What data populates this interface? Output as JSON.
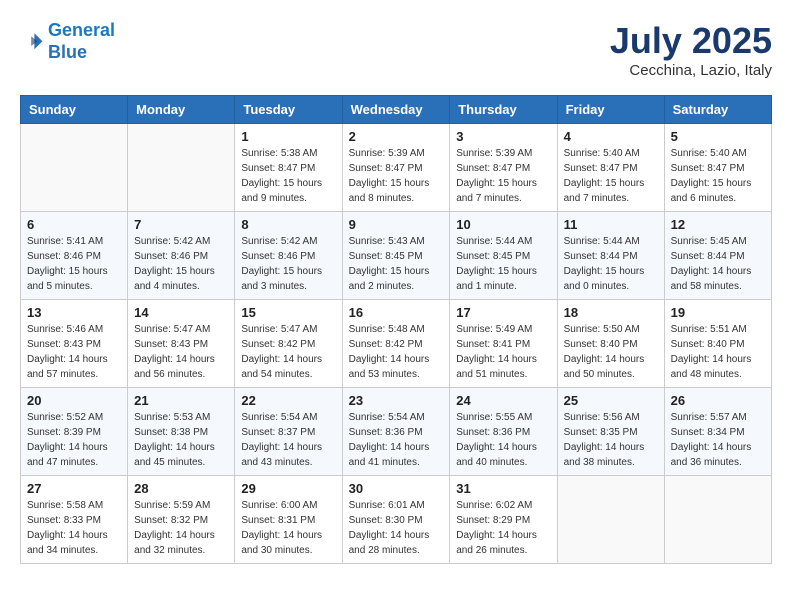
{
  "header": {
    "logo_line1": "General",
    "logo_line2": "Blue",
    "month": "July 2025",
    "location": "Cecchina, Lazio, Italy"
  },
  "weekdays": [
    "Sunday",
    "Monday",
    "Tuesday",
    "Wednesday",
    "Thursday",
    "Friday",
    "Saturday"
  ],
  "weeks": [
    [
      {
        "day": "",
        "info": ""
      },
      {
        "day": "",
        "info": ""
      },
      {
        "day": "1",
        "info": "Sunrise: 5:38 AM\nSunset: 8:47 PM\nDaylight: 15 hours\nand 9 minutes."
      },
      {
        "day": "2",
        "info": "Sunrise: 5:39 AM\nSunset: 8:47 PM\nDaylight: 15 hours\nand 8 minutes."
      },
      {
        "day": "3",
        "info": "Sunrise: 5:39 AM\nSunset: 8:47 PM\nDaylight: 15 hours\nand 7 minutes."
      },
      {
        "day": "4",
        "info": "Sunrise: 5:40 AM\nSunset: 8:47 PM\nDaylight: 15 hours\nand 7 minutes."
      },
      {
        "day": "5",
        "info": "Sunrise: 5:40 AM\nSunset: 8:47 PM\nDaylight: 15 hours\nand 6 minutes."
      }
    ],
    [
      {
        "day": "6",
        "info": "Sunrise: 5:41 AM\nSunset: 8:46 PM\nDaylight: 15 hours\nand 5 minutes."
      },
      {
        "day": "7",
        "info": "Sunrise: 5:42 AM\nSunset: 8:46 PM\nDaylight: 15 hours\nand 4 minutes."
      },
      {
        "day": "8",
        "info": "Sunrise: 5:42 AM\nSunset: 8:46 PM\nDaylight: 15 hours\nand 3 minutes."
      },
      {
        "day": "9",
        "info": "Sunrise: 5:43 AM\nSunset: 8:45 PM\nDaylight: 15 hours\nand 2 minutes."
      },
      {
        "day": "10",
        "info": "Sunrise: 5:44 AM\nSunset: 8:45 PM\nDaylight: 15 hours\nand 1 minute."
      },
      {
        "day": "11",
        "info": "Sunrise: 5:44 AM\nSunset: 8:44 PM\nDaylight: 15 hours\nand 0 minutes."
      },
      {
        "day": "12",
        "info": "Sunrise: 5:45 AM\nSunset: 8:44 PM\nDaylight: 14 hours\nand 58 minutes."
      }
    ],
    [
      {
        "day": "13",
        "info": "Sunrise: 5:46 AM\nSunset: 8:43 PM\nDaylight: 14 hours\nand 57 minutes."
      },
      {
        "day": "14",
        "info": "Sunrise: 5:47 AM\nSunset: 8:43 PM\nDaylight: 14 hours\nand 56 minutes."
      },
      {
        "day": "15",
        "info": "Sunrise: 5:47 AM\nSunset: 8:42 PM\nDaylight: 14 hours\nand 54 minutes."
      },
      {
        "day": "16",
        "info": "Sunrise: 5:48 AM\nSunset: 8:42 PM\nDaylight: 14 hours\nand 53 minutes."
      },
      {
        "day": "17",
        "info": "Sunrise: 5:49 AM\nSunset: 8:41 PM\nDaylight: 14 hours\nand 51 minutes."
      },
      {
        "day": "18",
        "info": "Sunrise: 5:50 AM\nSunset: 8:40 PM\nDaylight: 14 hours\nand 50 minutes."
      },
      {
        "day": "19",
        "info": "Sunrise: 5:51 AM\nSunset: 8:40 PM\nDaylight: 14 hours\nand 48 minutes."
      }
    ],
    [
      {
        "day": "20",
        "info": "Sunrise: 5:52 AM\nSunset: 8:39 PM\nDaylight: 14 hours\nand 47 minutes."
      },
      {
        "day": "21",
        "info": "Sunrise: 5:53 AM\nSunset: 8:38 PM\nDaylight: 14 hours\nand 45 minutes."
      },
      {
        "day": "22",
        "info": "Sunrise: 5:54 AM\nSunset: 8:37 PM\nDaylight: 14 hours\nand 43 minutes."
      },
      {
        "day": "23",
        "info": "Sunrise: 5:54 AM\nSunset: 8:36 PM\nDaylight: 14 hours\nand 41 minutes."
      },
      {
        "day": "24",
        "info": "Sunrise: 5:55 AM\nSunset: 8:36 PM\nDaylight: 14 hours\nand 40 minutes."
      },
      {
        "day": "25",
        "info": "Sunrise: 5:56 AM\nSunset: 8:35 PM\nDaylight: 14 hours\nand 38 minutes."
      },
      {
        "day": "26",
        "info": "Sunrise: 5:57 AM\nSunset: 8:34 PM\nDaylight: 14 hours\nand 36 minutes."
      }
    ],
    [
      {
        "day": "27",
        "info": "Sunrise: 5:58 AM\nSunset: 8:33 PM\nDaylight: 14 hours\nand 34 minutes."
      },
      {
        "day": "28",
        "info": "Sunrise: 5:59 AM\nSunset: 8:32 PM\nDaylight: 14 hours\nand 32 minutes."
      },
      {
        "day": "29",
        "info": "Sunrise: 6:00 AM\nSunset: 8:31 PM\nDaylight: 14 hours\nand 30 minutes."
      },
      {
        "day": "30",
        "info": "Sunrise: 6:01 AM\nSunset: 8:30 PM\nDaylight: 14 hours\nand 28 minutes."
      },
      {
        "day": "31",
        "info": "Sunrise: 6:02 AM\nSunset: 8:29 PM\nDaylight: 14 hours\nand 26 minutes."
      },
      {
        "day": "",
        "info": ""
      },
      {
        "day": "",
        "info": ""
      }
    ]
  ]
}
